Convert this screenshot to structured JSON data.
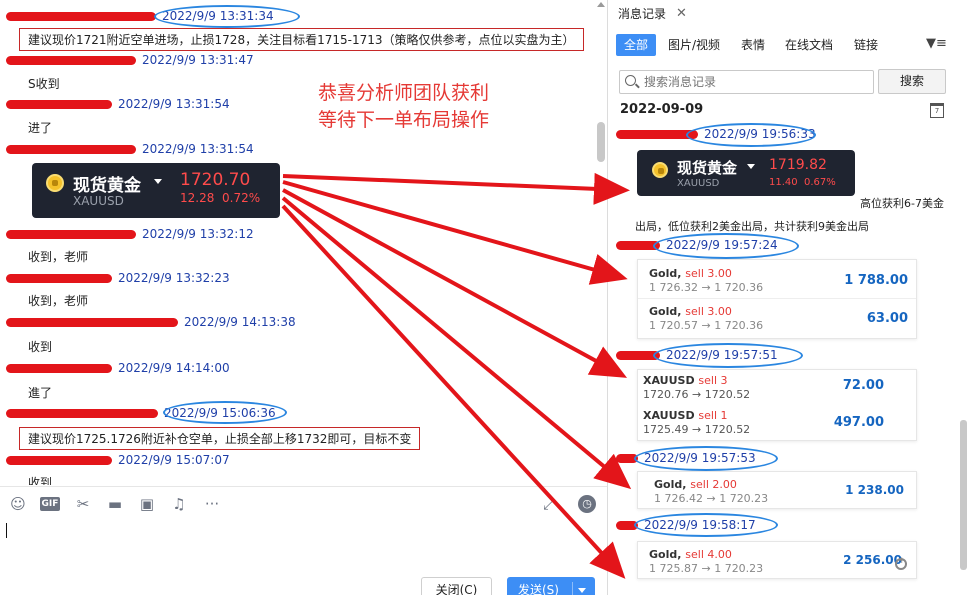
{
  "chat": {
    "messages": [
      {
        "time": "2022/9/9 13:31:34",
        "text": "建议现价1721附近空单进场，止损1728，关注目标看1715-1713（策略仅供参考，点位以实盘为主）"
      },
      {
        "time": "2022/9/9 13:31:47",
        "text": "S收到"
      },
      {
        "time": "2022/9/9 13:31:54",
        "text": "进了"
      },
      {
        "time": "2022/9/9 13:31:54",
        "text": ""
      },
      {
        "time": "2022/9/9 13:32:12",
        "text": "收到，老师"
      },
      {
        "time": "2022/9/9 13:32:23",
        "text": "收到，老师"
      },
      {
        "time": "2022/9/9 14:13:38",
        "text": "收到"
      },
      {
        "time": "2022/9/9 14:14:00",
        "text": "進了"
      },
      {
        "time": "2022/9/9 15:06:36",
        "text": "建议现价1725.1726附近补仓空单，止损全部上移1732即可，目标不变"
      },
      {
        "time": "2022/9/9 15:07:07",
        "text": "收到"
      }
    ],
    "promo_line1": "恭喜分析师团队获利",
    "promo_line2": "等待下一单布局操作",
    "gold_card": {
      "name": "现货黄金",
      "symbol": "XAUUSD",
      "price": "1720.70",
      "change": "12.28",
      "change_pct": "0.72%"
    }
  },
  "toolbar": {
    "icons": [
      "smiley-icon",
      "gif-icon",
      "scissors-icon",
      "folder-icon",
      "image-icon",
      "bell-off-icon",
      "more-icon"
    ],
    "gif_label": "GIF",
    "close_label": "关闭(C)",
    "send_label": "发送(S)"
  },
  "history": {
    "tab_title": "消息记录",
    "filters": [
      "全部",
      "图片/视频",
      "表情",
      "在线文档",
      "链接"
    ],
    "search_placeholder": "搜索消息记录",
    "search_button": "搜索",
    "date_heading": "2022-09-09",
    "calendar_label": "7",
    "entries": [
      {
        "time": "2022/9/9 19:56:33"
      },
      {
        "time": "2022/9/9 19:57:24"
      },
      {
        "time": "2022/9/9 19:57:51"
      },
      {
        "time": "2022/9/9 19:57:53"
      },
      {
        "time": "2022/9/9 19:58:17"
      }
    ],
    "gold_card": {
      "name": "现货黄金",
      "symbol": "XAUUSD",
      "price": "1719.82",
      "change": "11.40",
      "change_pct": "0.67%"
    },
    "summary_line1": "高位获利6-7美金",
    "summary_line2": "出局，低位获利2美金出局，共计获利9美金出局",
    "trades": [
      {
        "instrument": "Gold,",
        "side": "sell 3.00",
        "prices": "1 726.32 → 1 720.36",
        "profit": "1 788.00"
      },
      {
        "instrument": "Gold,",
        "side": "sell 3.00",
        "prices": "1 720.57 → 1 720.36",
        "profit": "63.00"
      },
      {
        "instrument": "XAUUSD",
        "side": "sell 3",
        "prices": "1720.76 → 1720.52",
        "profit": "72.00"
      },
      {
        "instrument": "XAUUSD",
        "side": "sell 1",
        "prices": "1725.49 → 1720.52",
        "profit": "497.00"
      },
      {
        "instrument": "Gold,",
        "side": "sell 2.00",
        "prices": "1 726.42 → 1 720.23",
        "profit": "1 238.00"
      },
      {
        "instrument": "Gold,",
        "side": "sell 4.00",
        "prices": "1 725.87 → 1 720.23",
        "profit": "2 256.00"
      }
    ]
  },
  "colors": {
    "accent": "#3d8ef5",
    "annotation_red": "#e53935",
    "ring_blue": "#2a86e0",
    "profit_blue": "#1565c0"
  }
}
